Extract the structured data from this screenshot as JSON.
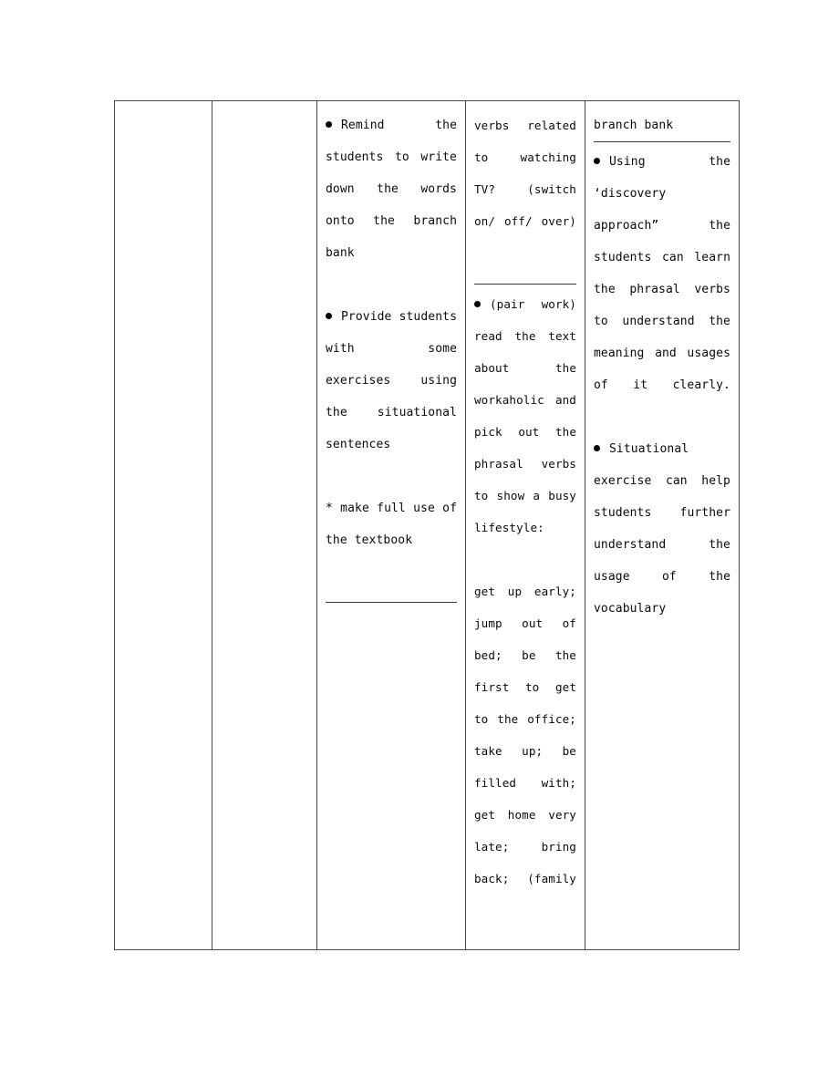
{
  "document": {
    "type": "lesson-plan-table",
    "page_background": "#ffffff",
    "border_color": "#4a4a4a"
  },
  "table": {
    "columns": [
      {
        "id": "col-1",
        "content": []
      },
      {
        "id": "col-2",
        "content": []
      },
      {
        "id": "col-3",
        "blocks": {
          "b1_bullet": "Remind",
          "b1_text": "the students to write down the words onto the branch bank",
          "b2_bullet": "Provide",
          "b2_text": "students with some exercises using the situational sentences",
          "b3_note": "* make full use of the textbook"
        },
        "has_rule_after": true
      },
      {
        "id": "col-4",
        "blocks": {
          "b1_text": "verbs related to watching TV? (switch on/ off/ over)",
          "b2_bullet": "(pair",
          "b2_text": "work) read the text about the workaholic and pick out the phrasal verbs to show a busy lifestyle:",
          "b3_list": "get up early; jump out of bed; be the first to get to the office; take up; be filled with; get home very late; bring back; (family"
        },
        "has_rule_after_first": true
      },
      {
        "id": "col-5",
        "blocks": {
          "b0_heading": "branch bank",
          "b1_bullet": "Using",
          "b1_text": "the ‘discovery approach” the students can learn the phrasal verbs to understand the meaning and usages of it clearly.",
          "b2_bullet": "Situational",
          "b2_text": "exercise can help students further understand the usage of the vocabulary"
        },
        "has_rule_after_heading": true
      }
    ]
  },
  "lines": {
    "col3": [
      "●  Remind      the",
      "students        to",
      "write  down   the",
      "words  onto   the",
      "branch bank",
      "●  Provide",
      "students      with",
      "some    exercises",
      "using         the",
      "situational",
      "sentences",
      "* make full use",
      "of the textbook"
    ],
    "col4": [
      "verbs",
      "related       to",
      "watching    TV?",
      "(switch     on/",
      "off/ over)",
      "●  (pair",
      "work)      read",
      "the        text",
      "about       the",
      "workaholic",
      "and pick out",
      "the     phrasal",
      "verbs        to",
      "show  a   busy",
      "lifestyle:",
      "get          up",
      "early;    jump",
      "out  of   bed;",
      "be the first",
      "to    get    to",
      "the    office;",
      "take  up;   be",
      "filled   with;",
      "get        home",
      "very     late;",
      "bring    back;",
      "(family"
    ],
    "col5": [
      "branch bank",
      "●  Using       the",
      " ‘discovery",
      "approach”     the",
      "students      can",
      "learn         the",
      "phrasal verbs to",
      "understand    the",
      "meaning       and",
      "usages   of    it",
      "clearly.",
      "●  Situational",
      "exercise      can",
      "help     students",
      "further",
      "understand    the",
      "usage   of    the",
      "vocabulary"
    ]
  }
}
